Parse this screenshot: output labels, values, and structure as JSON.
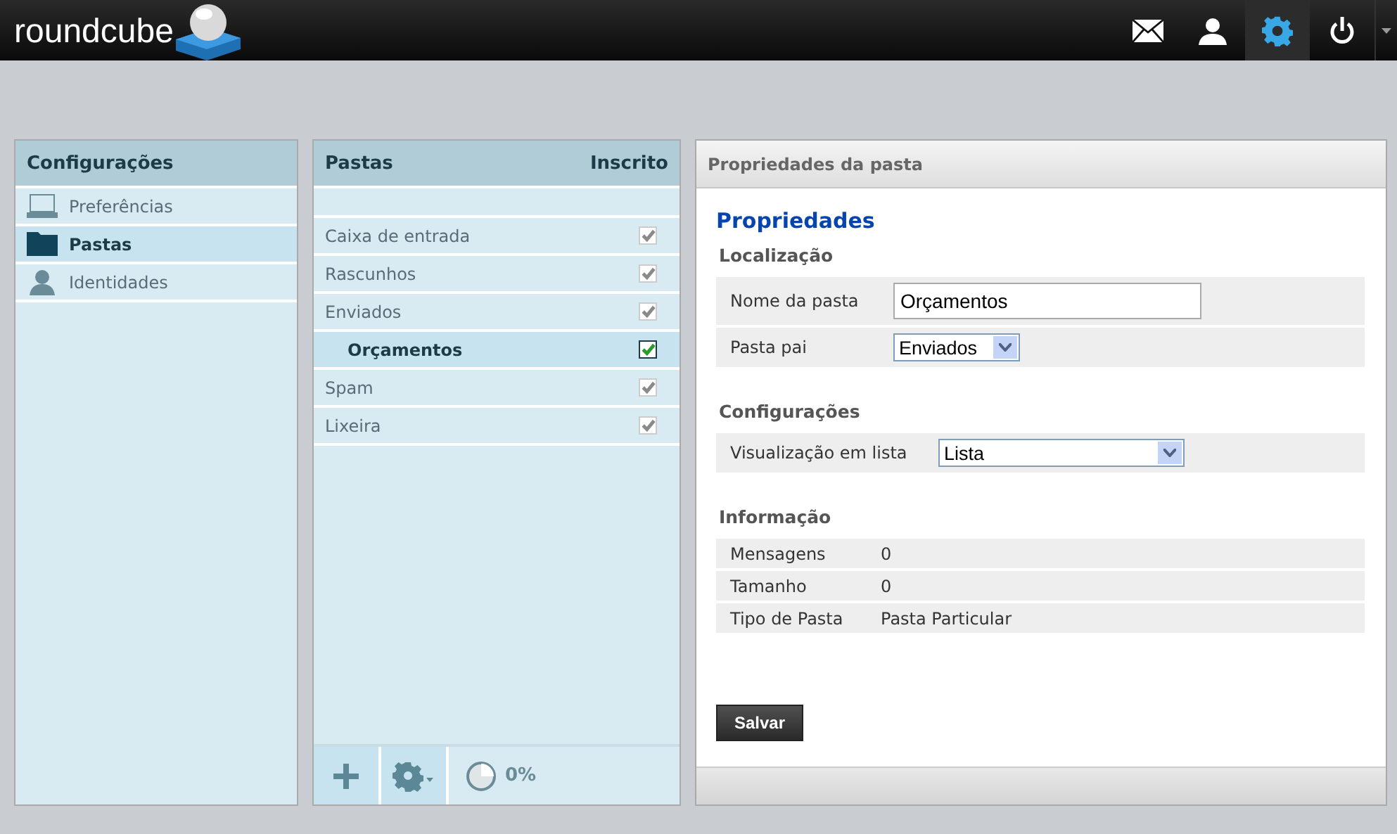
{
  "logo": "roundcube",
  "nav": [
    {
      "kind": "mail",
      "selected": false
    },
    {
      "kind": "user",
      "selected": false
    },
    {
      "kind": "settings",
      "selected": true
    },
    {
      "kind": "logout",
      "selected": false
    }
  ],
  "settings_panel": {
    "title": "Configurações",
    "items": [
      {
        "kind": "laptop",
        "label": "Preferências",
        "selected": false
      },
      {
        "kind": "folder",
        "label": "Pastas",
        "selected": true
      },
      {
        "kind": "person",
        "label": "Identidades",
        "selected": false
      }
    ]
  },
  "folders_panel": {
    "title": "Pastas",
    "column": "Inscrito",
    "folders": [
      {
        "name": "Caixa de entrada",
        "selected": false,
        "checked": true,
        "disabled": true
      },
      {
        "name": "Rascunhos",
        "selected": false,
        "checked": true,
        "disabled": true
      },
      {
        "name": "Enviados",
        "selected": false,
        "checked": true,
        "disabled": true,
        "children": [
          {
            "name": "Orçamentos",
            "selected": true,
            "checked": true,
            "disabled": false
          }
        ]
      },
      {
        "name": "Spam",
        "selected": false,
        "checked": true,
        "disabled": true
      },
      {
        "name": "Lixeira",
        "selected": false,
        "checked": true,
        "disabled": true
      }
    ],
    "quota": "0%"
  },
  "properties_panel": {
    "title": "Propriedades da pasta",
    "heading": "Propriedades",
    "sections": [
      {
        "title": "Localização",
        "rows": [
          {
            "kind": "input",
            "label": "Nome da pasta",
            "value": "Orçamentos"
          },
          {
            "kind": "select",
            "label": "Pasta pai",
            "value": "Enviados"
          }
        ]
      },
      {
        "title": "Configurações",
        "rows": [
          {
            "kind": "select",
            "label": "Visualização em lista",
            "value": "Lista"
          }
        ]
      },
      {
        "title": "Informação",
        "rows": [
          {
            "kind": "text",
            "label": "Mensagens",
            "value": "0"
          },
          {
            "kind": "text",
            "label": "Tamanho",
            "value": "0"
          },
          {
            "kind": "text",
            "label": "Tipo de Pasta",
            "value": "Pasta Particular"
          }
        ]
      }
    ],
    "save_button": "Salvar"
  }
}
